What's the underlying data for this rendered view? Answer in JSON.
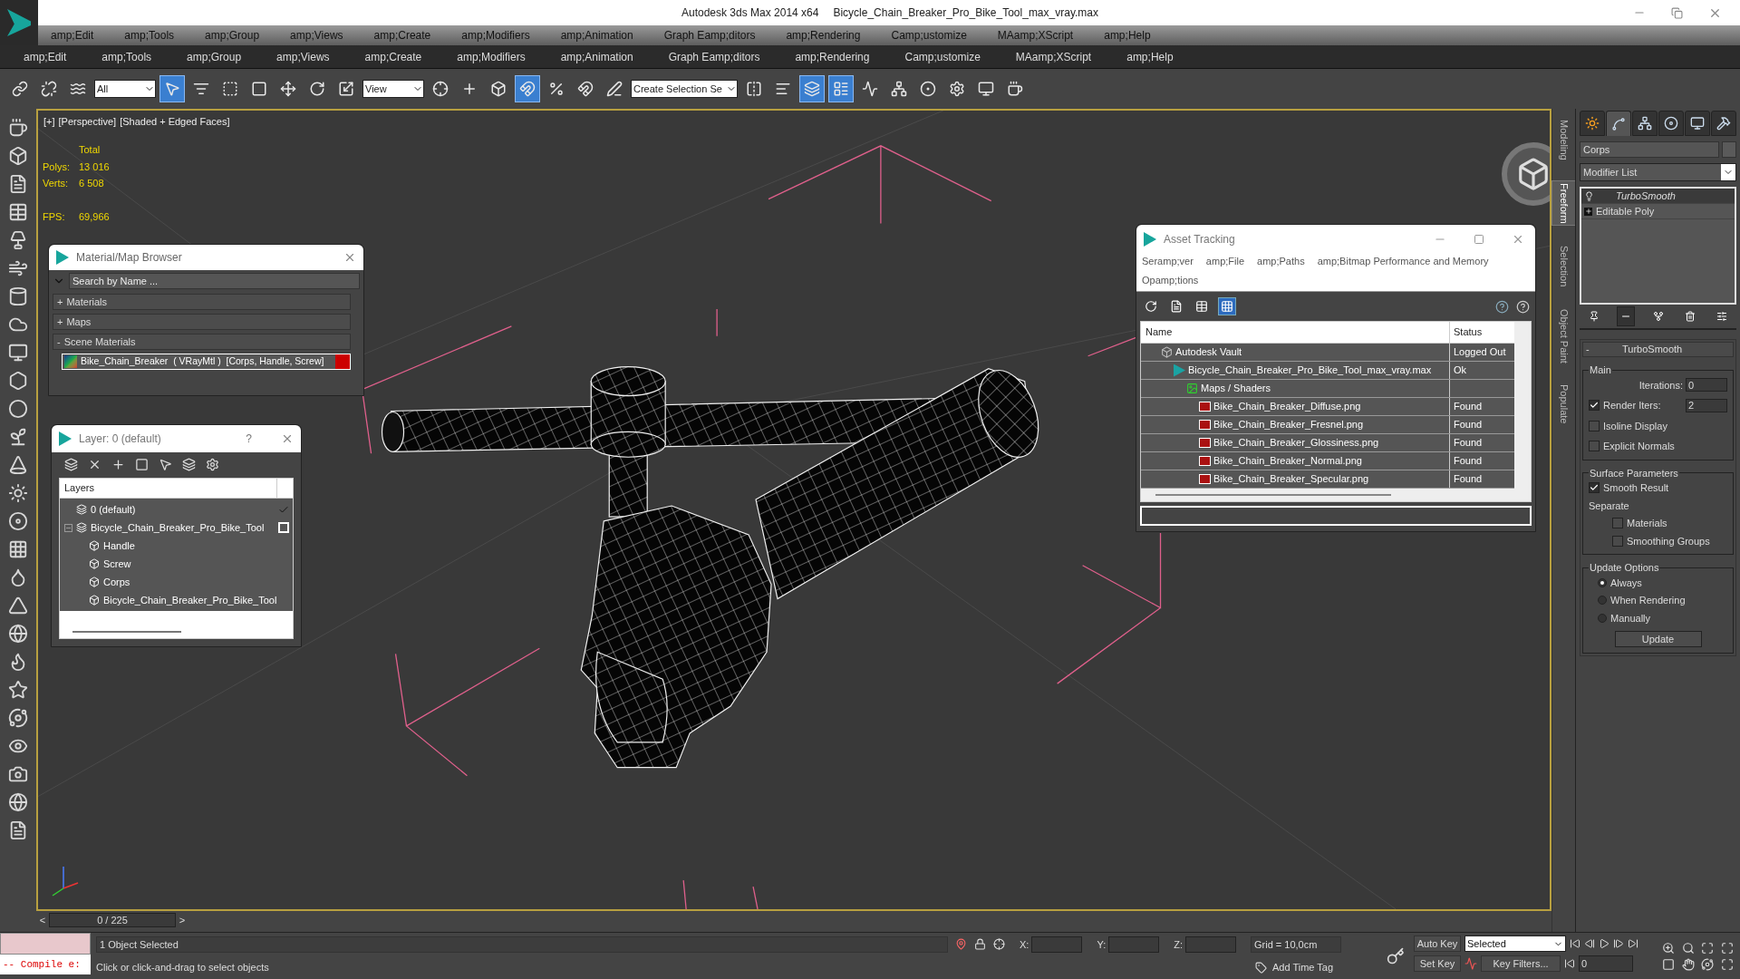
{
  "window": {
    "app": "Autodesk 3ds Max  2014 x64",
    "file": "Bicycle_Chain_Breaker_Pro_Bike_Tool_max_vray.max"
  },
  "menu_bar_1": [
    "amp;Edit",
    "amp;Tools",
    "amp;Group",
    "amp;Views",
    "amp;Create",
    "amp;Modifiers",
    "amp;Animation",
    "Graph Eamp;ditors",
    "amp;Rendering",
    "Camp;ustomize",
    "MAamp;XScript",
    "amp;Help"
  ],
  "menu_bar_2": [
    "amp;Edit",
    "amp;Tools",
    "amp;Group",
    "amp;Views",
    "amp;Create",
    "amp;Modifiers",
    "amp;Animation",
    "Graph Eamp;ditors",
    "amp;Rendering",
    "Camp;ustomize",
    "MAamp;XScript",
    "amp;Help"
  ],
  "toolbar": [
    {
      "kind": "button",
      "selected": false
    },
    {
      "kind": "button",
      "selected": false
    },
    {
      "kind": "button",
      "selected": false
    },
    {
      "kind": "dropdown",
      "value": "All"
    },
    {
      "kind": "button",
      "selected": true
    },
    {
      "kind": "button",
      "selected": false
    },
    {
      "kind": "button",
      "selected": false
    },
    {
      "kind": "button",
      "selected": false
    },
    {
      "kind": "button",
      "selected": false
    },
    {
      "kind": "button",
      "selected": false
    },
    {
      "kind": "button",
      "selected": false
    },
    {
      "kind": "dropdown",
      "value": "View"
    },
    {
      "kind": "button",
      "selected": false
    },
    {
      "kind": "button",
      "selected": false
    },
    {
      "kind": "button",
      "selected": false
    },
    {
      "kind": "button",
      "selected": true
    },
    {
      "kind": "button",
      "selected": false
    },
    {
      "kind": "button",
      "selected": false
    },
    {
      "kind": "button",
      "selected": false
    },
    {
      "kind": "dropdown",
      "value": "Create Selection Se"
    },
    {
      "kind": "button",
      "selected": false
    },
    {
      "kind": "button",
      "selected": false
    },
    {
      "kind": "button",
      "selected": true
    },
    {
      "kind": "button",
      "selected": true
    },
    {
      "kind": "button",
      "selected": false
    },
    {
      "kind": "button",
      "selected": false
    },
    {
      "kind": "button",
      "selected": false
    },
    {
      "kind": "button",
      "selected": false
    },
    {
      "kind": "button",
      "selected": false
    },
    {
      "kind": "button",
      "selected": false
    }
  ],
  "viewport": {
    "labels": [
      "[+]",
      "[Perspective]",
      "[Shaded + Edged Faces]"
    ],
    "stats": {
      "header": "Total",
      "rows": [
        {
          "label": "Polys:",
          "value": "13 016"
        },
        {
          "label": "Verts:",
          "value": "6 508"
        }
      ],
      "fps_label": "FPS:",
      "fps_value": "69,966"
    }
  },
  "material_browser": {
    "title": "Material/Map Browser",
    "search_placeholder": "Search by Name ...",
    "groups": [
      {
        "sign": "+",
        "label": "Materials"
      },
      {
        "sign": "+",
        "label": "Maps"
      },
      {
        "sign": "-",
        "label": "Scene Materials"
      }
    ],
    "materials": [
      "Bike_Chain_Breaker  ( VRayMtl )  [Corps, Handle, Screw]"
    ]
  },
  "layer_window": {
    "title": "Layer: 0 (default)",
    "help": "?",
    "header": "Layers",
    "layers": [
      {
        "name": "0 (default)",
        "current": true
      },
      {
        "name": "Bicycle_Chain_Breaker_Pro_Bike_Tool",
        "current": false,
        "expanded": true,
        "children": [
          {
            "name": "Handle"
          },
          {
            "name": "Screw"
          },
          {
            "name": "Corps"
          },
          {
            "name": "Bicycle_Chain_Breaker_Pro_Bike_Tool"
          }
        ]
      }
    ]
  },
  "asset_tracking": {
    "title": "Asset Tracking",
    "menus": [
      "Seramp;ver",
      "amp;File",
      "amp;Paths",
      "amp;Bitmap Performance and Memory",
      "Opamp;tions"
    ],
    "toolbar": [
      {
        "selected": false
      },
      {
        "selected": false
      },
      {
        "selected": false
      },
      {
        "selected": true
      }
    ],
    "columns": [
      "Name",
      "Status"
    ],
    "rows": [
      {
        "kind": "vault",
        "name": "Autodesk Vault",
        "status": "Logged Out",
        "children": [
          {
            "kind": "scene",
            "name": "Bicycle_Chain_Breaker_Pro_Bike_Tool_max_vray.max",
            "status": "Ok",
            "children": [
              {
                "kind": "folder",
                "name": "Maps / Shaders",
                "children": [
                  {
                    "kind": "png",
                    "name": "Bike_Chain_Breaker_Diffuse.png",
                    "status": "Found"
                  },
                  {
                    "kind": "png",
                    "name": "Bike_Chain_Breaker_Fresnel.png",
                    "status": "Found"
                  },
                  {
                    "kind": "png",
                    "name": "Bike_Chain_Breaker_Glossiness.png",
                    "status": "Found"
                  },
                  {
                    "kind": "png",
                    "name": "Bike_Chain_Breaker_Normal.png",
                    "status": "Found"
                  },
                  {
                    "kind": "png",
                    "name": "Bike_Chain_Breaker_Specular.png",
                    "status": "Found"
                  }
                ]
              }
            ]
          }
        ]
      }
    ]
  },
  "side_tabs": [
    {
      "label": "Modeling",
      "selected": false
    },
    {
      "label": "Freeform",
      "selected": true
    },
    {
      "label": "Selection",
      "selected": false
    },
    {
      "label": "Object Paint",
      "selected": false
    },
    {
      "label": "Populate",
      "selected": false
    }
  ],
  "command_panel": {
    "tabs": [
      {
        "selected": false
      },
      {
        "selected": true
      },
      {
        "selected": false
      },
      {
        "selected": false
      },
      {
        "selected": false
      },
      {
        "selected": false
      }
    ],
    "object_name": "Corps",
    "modifier_list": "Modifier List",
    "stack": [
      {
        "kind": "modifier",
        "name": "TurboSmooth",
        "selected": true
      },
      {
        "kind": "base",
        "name": "Editable Poly",
        "selected": false
      }
    ],
    "stack_tools": [
      {
        "selected": false
      },
      {
        "selected": true
      },
      {
        "selected": false
      },
      {
        "selected": false
      },
      {
        "selected": false
      }
    ],
    "rollout": {
      "sign": "-",
      "title": "TurboSmooth",
      "main": {
        "title": "Main",
        "iterations_label": "Iterations:",
        "iterations": "0",
        "render_iters_label": "Render Iters:",
        "render_iters_checked": true,
        "render_iters": "2",
        "options": [
          {
            "label": "Isoline Display",
            "checked": false
          },
          {
            "label": "Explicit Normals",
            "checked": false
          }
        ]
      },
      "surface": {
        "title": "Surface Parameters",
        "smooth_result": {
          "label": "Smooth Result",
          "checked": true
        },
        "separate": "Separate",
        "options": [
          {
            "label": "Materials",
            "checked": false
          },
          {
            "label": "Smoothing Groups",
            "checked": false
          }
        ]
      },
      "update": {
        "title": "Update Options",
        "options": [
          {
            "label": "Always",
            "selected": true
          },
          {
            "label": "When Rendering",
            "selected": false
          },
          {
            "label": "Manually",
            "selected": false
          }
        ],
        "button": "Update"
      }
    }
  },
  "time_slider": {
    "prev": "<",
    "position": "0 / 225",
    "next": ">"
  },
  "status": {
    "listener_output": "-- Compile e:",
    "selection": "1 Object Selected",
    "prompt": "Click or click-and-drag to select objects",
    "coords": [
      "X:",
      "Y:",
      "Z:"
    ],
    "grid": "Grid = 10,0cm",
    "add_time_tag": "Add Time Tag",
    "auto_key": "Auto Key",
    "key_mode": "Selected",
    "set_key": "Set Key",
    "key_filters": "Key Filters...",
    "frame": "0"
  }
}
